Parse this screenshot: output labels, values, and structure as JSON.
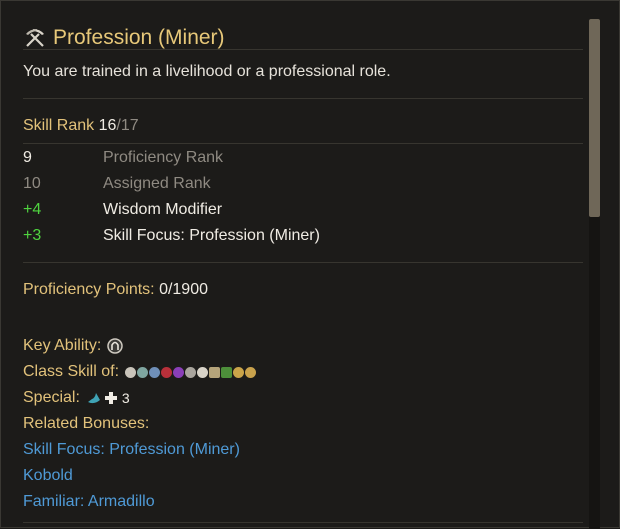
{
  "header": {
    "title": "Profession (Miner)",
    "icon": "crossed-pickaxes-icon"
  },
  "description": "You are trained in a livelihood or a professional role.",
  "skill_rank": {
    "label": "Skill Rank",
    "current": "16",
    "max": "/17"
  },
  "breakdown": [
    {
      "value": "9",
      "label": "Proficiency Rank",
      "value_color": "#f0ece4",
      "label_color": "#8f8a82"
    },
    {
      "value": "10",
      "label": "Assigned Rank",
      "value_color": "#8f8a82",
      "label_color": "#8f8a82"
    },
    {
      "value": "+4",
      "label": "Wisdom Modifier",
      "value_color": "#4fd43f",
      "label_color": "#f0ece4"
    },
    {
      "value": "+3",
      "label": "Skill Focus: Profession (Miner)",
      "value_color": "#4fd43f",
      "label_color": "#f0ece4"
    }
  ],
  "proficiency_points": {
    "label": "Proficiency Points:",
    "value": "0/1900"
  },
  "key_ability": {
    "label": "Key Ability:",
    "icon": "wisdom-ability-icon"
  },
  "class_skill": {
    "label": "Class Skill of:",
    "icons": [
      "class-icon-1",
      "class-icon-2",
      "class-icon-3",
      "class-icon-4",
      "class-icon-5",
      "class-icon-6",
      "class-icon-7",
      "class-icon-8",
      "class-icon-9",
      "class-icon-10",
      "class-icon-11"
    ]
  },
  "special": {
    "label": "Special:",
    "icon": "special-ability-icon",
    "value": "3"
  },
  "related_bonuses": {
    "label": "Related Bonuses:",
    "items": [
      "Skill Focus: Profession (Miner)",
      "Kobold",
      "Familiar: Armadillo"
    ]
  },
  "colors": {
    "title": "#e7c879",
    "label_gold": "#e2c27b",
    "positive": "#4fd43f",
    "link": "#4f9ad6",
    "muted": "#8f8a82"
  }
}
